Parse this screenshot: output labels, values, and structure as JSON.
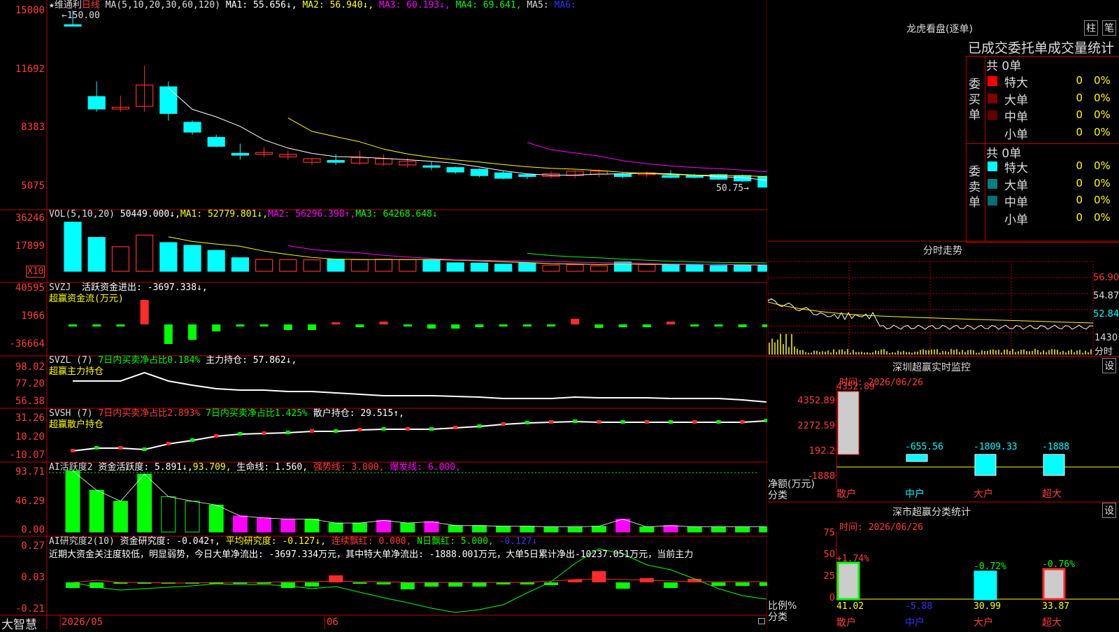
{
  "colors": {
    "up": "#ff2b2b",
    "down": "#00ffff",
    "ma1": "#ffffff",
    "ma2": "#ffff00",
    "ma3": "#ff00ff",
    "ma4": "#00ff00",
    "ma5": "#3333ff",
    "green": "#00ff00",
    "magenta": "#ff00ff",
    "yellow": "#ffff00",
    "grid": "#c00000"
  },
  "header": {
    "stock": "★维通利",
    "period": "日线",
    "ma_params": "MA(5,10,20,30,60,120)",
    "ma1": "MA1: 55.656↓,",
    "ma2": "MA2: 56.940↓,",
    "ma3": "MA3: 60.193↓,",
    "ma4": "MA4: 69.641,",
    "ma5": "MA5:",
    "ma6": "MA6:",
    "high_mark": "150.00",
    "low_mark": "50.75"
  },
  "price_axis": [
    "15000",
    "11692",
    "8383",
    "5075"
  ],
  "vol_panel": {
    "title": "VOL(5,10,20)",
    "value": "50449.000↓,",
    "ma1": "MA1: 52779.801↓,",
    "ma2": "MA2: 56296.398↑,",
    "ma3": "MA3: 64268.648↓",
    "axis": [
      "36246",
      "17899"
    ],
    "unit": "X10"
  },
  "svzj_panel": {
    "title": "SVZJ",
    "label": "活跃资金进出: -3697.338↓,",
    "sub": "超赢资金流(万元)",
    "axis": [
      "40595",
      "1966",
      "-36664"
    ]
  },
  "svzl_panel": {
    "title": "SVZL (7)",
    "text1": "7日内买卖净占比0.184%",
    "text2": "主力持仓: 57.862↓,",
    "sub": "超赢主力持仓",
    "axis": [
      "98.02",
      "77.20",
      "56.38"
    ]
  },
  "svsh_panel": {
    "title": "SVSH (7)",
    "text1": "7日内买卖净占比2.893%",
    "text2": "7日内买卖净占比1.425%",
    "text3": "散户持仓: 29.515↑,",
    "sub": "超赢散户持仓",
    "axis": [
      "31.26",
      "10.20",
      "-10.07"
    ]
  },
  "ai_active": {
    "title": "AI活跃度2",
    "t1": "资金活跃度: 5.891↓,",
    "t2": "93.709,",
    "t3": "生命线: 1.560,",
    "t4": "强势线: 3.000,",
    "t5": "爆发线: 6.000,",
    "axis": [
      "93.71",
      "46.29",
      "0.00"
    ]
  },
  "ai_research": {
    "title": "AI研究度2(10)",
    "t1": "资金研究度: -0.042↑,",
    "t2": "平均研究度: -0.127↓,",
    "t3": "连续飘红: 0.000,",
    "t4": "N日飘红: 5.000,",
    "t5": "-0.127↓",
    "comment": "近期大资金关注度较低，明显弱势，今日大单净流出: -3697.334万元，其中特大单净流出: -1888.001万元，大单5日累计净出-10237.051万元，当前主力",
    "axis": [
      "0.27",
      "0.03",
      "-0.21"
    ]
  },
  "bottom": {
    "brand": "大智慧",
    "date1": "2026/05",
    "date2": "06"
  },
  "dragon": {
    "title": "龙虎看盘(逐单)",
    "btn1": "柱",
    "btn2": "笔",
    "subtitle": "已成交委托单成交量统计",
    "buy": {
      "side": "委买单",
      "total": "共 0单",
      "rows": [
        {
          "label": "特大",
          "val": "0",
          "pct": "0%",
          "color": "#ff0000"
        },
        {
          "label": "大单",
          "val": "0",
          "pct": "0%",
          "color": "#800000"
        },
        {
          "label": "中单",
          "val": "0",
          "pct": "0%",
          "color": "#600000"
        },
        {
          "label": "小单",
          "val": "0",
          "pct": "0%",
          "color": "#000000"
        }
      ]
    },
    "sell": {
      "side": "委卖单",
      "total": "共 0单",
      "rows": [
        {
          "label": "特大",
          "val": "0",
          "pct": "0%",
          "color": "#00ffff"
        },
        {
          "label": "大单",
          "val": "0",
          "pct": "0%",
          "color": "#008080"
        },
        {
          "label": "中单",
          "val": "0",
          "pct": "0%",
          "color": "#007070"
        },
        {
          "label": "小单",
          "val": "0",
          "pct": "0%",
          "color": "#000000"
        }
      ]
    }
  },
  "intraday": {
    "title": "分时走势",
    "axis": [
      "56.90",
      "54.87",
      "52.84"
    ],
    "vol_label": "1430",
    "time_label": "分时"
  },
  "monitor": {
    "title": "深圳超赢实时监控",
    "btn": "设",
    "time": "时间: 2026/06/26",
    "axis": [
      "4352.89",
      "2272.59",
      "192.2",
      "-1888"
    ],
    "ylabel": "净额(万元)",
    "xlabel": "分类",
    "bars": [
      {
        "label": "散户",
        "value": "4352.89"
      },
      {
        "label": "中户",
        "value": "-655.56"
      },
      {
        "label": "大户",
        "value": "-1809.33"
      },
      {
        "label": "超大",
        "value": "-1888"
      }
    ]
  },
  "classify": {
    "title": "深市超赢分类统计",
    "btn": "设",
    "time": "时间: 2026/06/26",
    "axis": [
      "75",
      "50",
      "25",
      "0"
    ],
    "ylabel": "比例%",
    "xlabel": "分类",
    "bars": [
      {
        "label": "散户",
        "top": "+1.74%",
        "value": "41.02"
      },
      {
        "label": "中户",
        "top": "",
        "value": "-5.88"
      },
      {
        "label": "大户",
        "top": "-0.72%",
        "value": "30.99"
      },
      {
        "label": "超大",
        "top": "-0.76%",
        "value": "33.87"
      }
    ]
  },
  "chart_data": [
    {
      "type": "candlestick",
      "title": "日线",
      "x": [
        "c1",
        "c2",
        "c3",
        "c4",
        "c5",
        "c6",
        "c7",
        "c8",
        "c9",
        "c10",
        "c11",
        "c12",
        "c13",
        "c14",
        "c15",
        "c16",
        "c17",
        "c18",
        "c19",
        "c20",
        "c21",
        "c22",
        "c23",
        "c24",
        "c25",
        "c26",
        "c27",
        "c28",
        "c29",
        "c30"
      ],
      "open": [
        14200,
        10150,
        9450,
        9600,
        10700,
        8700,
        7850,
        6950,
        6900,
        6750,
        6450,
        6550,
        6400,
        6350,
        6300,
        6250,
        6150,
        6050,
        5850,
        5750,
        5650,
        5700,
        5780,
        5800,
        5750,
        5700,
        5720,
        5750,
        5700,
        5650
      ],
      "close": [
        14200,
        9450,
        9550,
        10800,
        9200,
        8150,
        7350,
        6850,
        7000,
        6900,
        6650,
        6450,
        6700,
        6650,
        6500,
        6200,
        5900,
        5700,
        5550,
        5650,
        5800,
        5950,
        5950,
        5650,
        5850,
        5600,
        5600,
        5500,
        5400,
        5050
      ],
      "high": [
        15000,
        11000,
        10200,
        11900,
        11000,
        8800,
        8000,
        7500,
        7300,
        7100,
        6700,
        6900,
        7100,
        6900,
        6700,
        6500,
        6200,
        6100,
        5950,
        5800,
        5950,
        6000,
        6050,
        5900,
        5950,
        6000,
        5800,
        5800,
        5750,
        5700
      ],
      "low": [
        14150,
        9300,
        9300,
        9300,
        8800,
        8000,
        7300,
        6600,
        6750,
        6600,
        6300,
        6300,
        6300,
        6250,
        6150,
        6000,
        5800,
        5600,
        5500,
        5500,
        5550,
        5550,
        5600,
        5550,
        5600,
        5550,
        5550,
        5450,
        5350,
        5050
      ]
    },
    {
      "type": "bar",
      "title": "VOL",
      "values": [
        36000,
        24800,
        18000,
        26500,
        21000,
        19000,
        15300,
        9900,
        8700,
        8500,
        8400,
        8800,
        8500,
        8800,
        8600,
        8500,
        6200,
        6000,
        5200,
        6100,
        4500,
        4800,
        4000,
        6800,
        5000,
        4700,
        5000,
        4200,
        4600,
        4500
      ],
      "ylim": [
        0,
        40000
      ]
    }
  ]
}
